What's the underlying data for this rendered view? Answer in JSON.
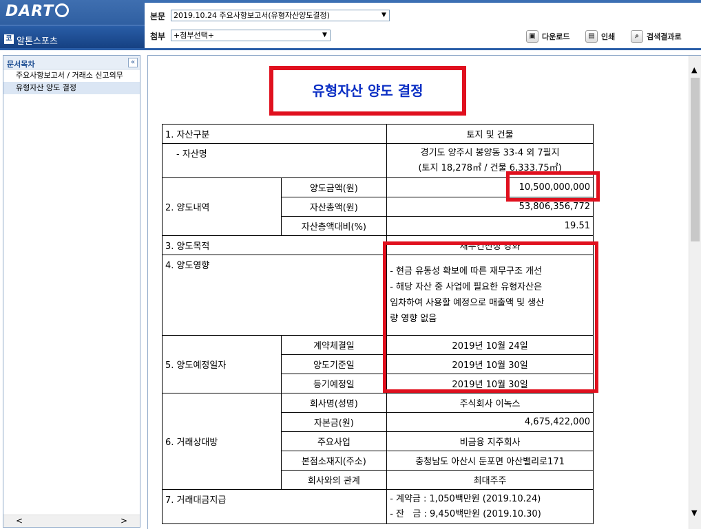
{
  "app": {
    "logo": "DART",
    "company": "알톤스포츠",
    "company_icon": "코"
  },
  "header": {
    "main_label": "본문",
    "main_select": "2019.10.24  주요사항보고서(유형자산양도결정)",
    "attach_label": "첨부",
    "attach_select": "+첨부선택+",
    "download": "다운로드",
    "print": "인쇄",
    "search_results": "검색결과로"
  },
  "sidebar": {
    "title": "문서목차",
    "items": [
      {
        "label": "주요사항보고서 / 거래소 신고의무"
      },
      {
        "label": "유형자산 양도 결정"
      }
    ]
  },
  "document": {
    "title": "유형자산 양도 결정",
    "rows": {
      "asset_type_label": "1. 자산구분",
      "asset_type_value": "토지 및 건물",
      "asset_name_label": "- 자산명",
      "asset_name_line1": "경기도 양주시 봉양동 33-4 외 7필지",
      "asset_name_line2": "(토지 18,278㎡ / 건물 6,333.75㎡)",
      "transfer_label": "2. 양도내역",
      "transfer_amount_label": "양도금액(원)",
      "transfer_amount_value": "10,500,000,000",
      "total_assets_label": "자산총액(원)",
      "total_assets_value": "53,806,356,772",
      "ratio_label": "자산총액대비(%)",
      "ratio_value": "19.51",
      "purpose_label": "3. 양도목적",
      "purpose_value": "재무건전성 강화",
      "impact_label": "4. 양도영향",
      "impact_line1": "- 현금 유동성 확보에 따른 재무구조 개선",
      "impact_line2": "- 해당 자산 중 사업에 필요한 유형자산은",
      "impact_line3": "임차하여 사용할 예정으로 매출액 및 생산",
      "impact_line4": "량 영향 없음",
      "schedule_label": "5. 양도예정일자",
      "contract_date_label": "계약체결일",
      "contract_date_value": "2019년 10월 24일",
      "base_date_label": "양도기준일",
      "base_date_value": "2019년 10월 30일",
      "registration_date_label": "등기예정일",
      "registration_date_value": "2019년 10월 30일",
      "counterparty_label": "6. 거래상대방",
      "cp_name_label": "회사명(성명)",
      "cp_name_value": "주식회사 이녹스",
      "cp_capital_label": "자본금(원)",
      "cp_capital_value": "4,675,422,000",
      "cp_business_label": "주요사업",
      "cp_business_value": "비금융 지주회사",
      "cp_address_label": "본점소재지(주소)",
      "cp_address_value": "충청남도 아산시 둔포면 아산밸리로171",
      "cp_relation_label": "회사와의 관계",
      "cp_relation_value": "최대주주",
      "payment_label": "7. 거래대금지급",
      "payment_line1": "- 계약금 : 1,050백만원 (2019.10.24)",
      "payment_line2": "- 잔   금 : 9,450백만원 (2019.10.30)"
    }
  },
  "colors": {
    "header_blue": "#1f4f93",
    "highlight_red": "#e0101e",
    "title_blue": "#0b2fc4"
  }
}
